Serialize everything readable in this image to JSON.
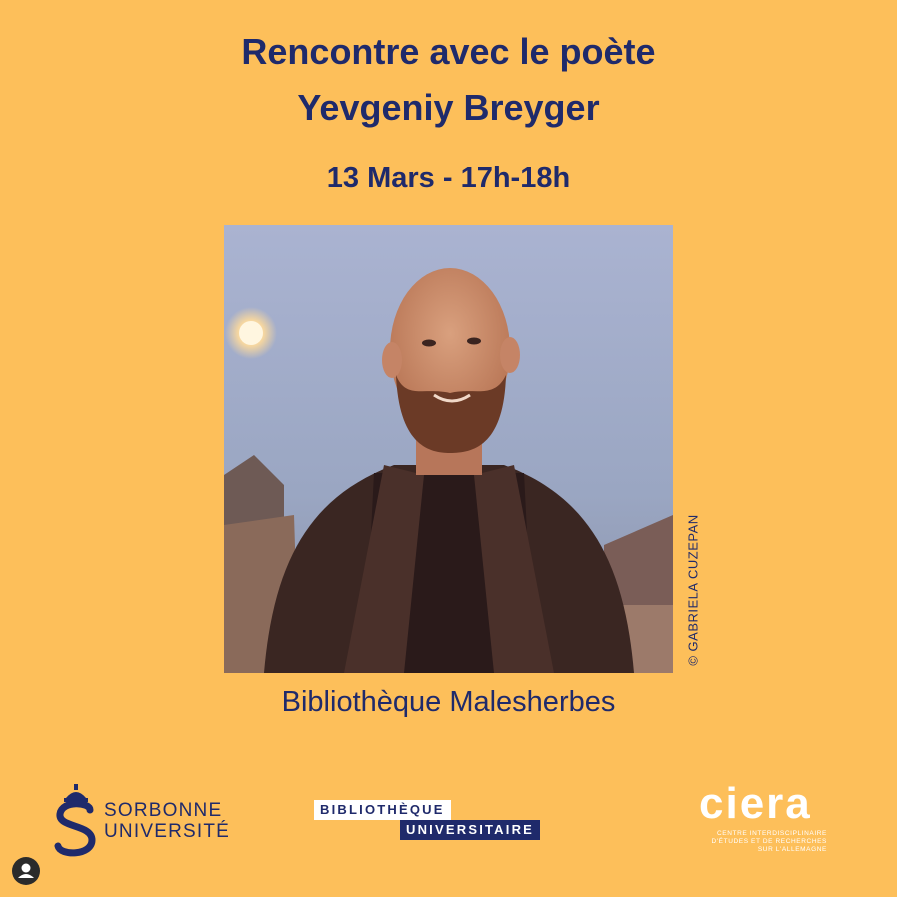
{
  "header": {
    "title_line1": "Rencontre avec le poète",
    "title_line2": "Yevgeniy Breyger",
    "date": "13 Mars - 17h-18h"
  },
  "photo": {
    "credit": "© GABRIELA CUZEPAN"
  },
  "venue": "Bibliothèque Malesherbes",
  "logos": {
    "sorbonne_line1": "SORBONNE",
    "sorbonne_line2": "UNIVERSITÉ",
    "bu_line1": "BIBLIOTHÈQUE",
    "bu_line2": "UNIVERSITAIRE",
    "ciera_word": "ciera",
    "ciera_sub1": "CENTRE INTERDISCIPLINAIRE",
    "ciera_sub2": "D'ÉTUDES ET DE RECHERCHES",
    "ciera_sub3": "SUR L'ALLEMAGNE"
  },
  "colors": {
    "background": "#fdbf5a",
    "navy": "#1f2a6b"
  }
}
